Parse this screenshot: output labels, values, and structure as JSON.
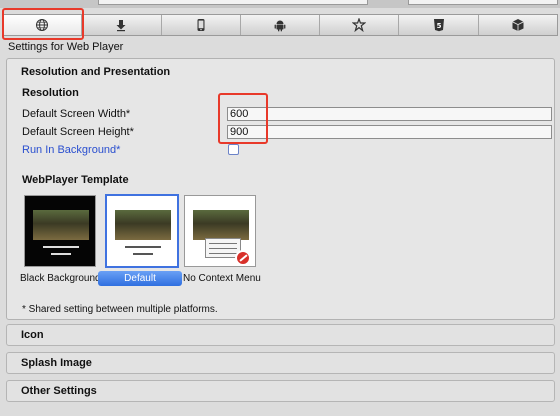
{
  "tabs": [
    {
      "icon": "globe-icon",
      "active": true
    },
    {
      "icon": "download-icon",
      "active": false
    },
    {
      "icon": "phone-icon",
      "active": false
    },
    {
      "icon": "android-icon",
      "active": false
    },
    {
      "icon": "blackberry-icon",
      "active": false
    },
    {
      "icon": "html5-icon",
      "active": false
    },
    {
      "icon": "package-icon",
      "active": false
    }
  ],
  "settings_for": "Settings for Web Player",
  "resolution_presentation": {
    "title": "Resolution and Presentation",
    "resolution_heading": "Resolution",
    "width_label": "Default Screen Width*",
    "width_value": "600",
    "height_label": "Default Screen Height*",
    "height_value": "900",
    "run_bg_label": "Run In Background*",
    "run_bg_checked": false,
    "template_heading": "WebPlayer Template",
    "templates": [
      {
        "label": "Black Background",
        "selected": false
      },
      {
        "label": "Default",
        "selected": true
      },
      {
        "label": "No Context Menu",
        "selected": false
      }
    ],
    "shared_note": "* Shared setting between multiple platforms."
  },
  "sections": [
    "Icon",
    "Splash Image",
    "Other Settings"
  ],
  "colors": {
    "highlight": "#e8392a",
    "selected": "#2f6fe0",
    "link": "#2a4fcf"
  }
}
